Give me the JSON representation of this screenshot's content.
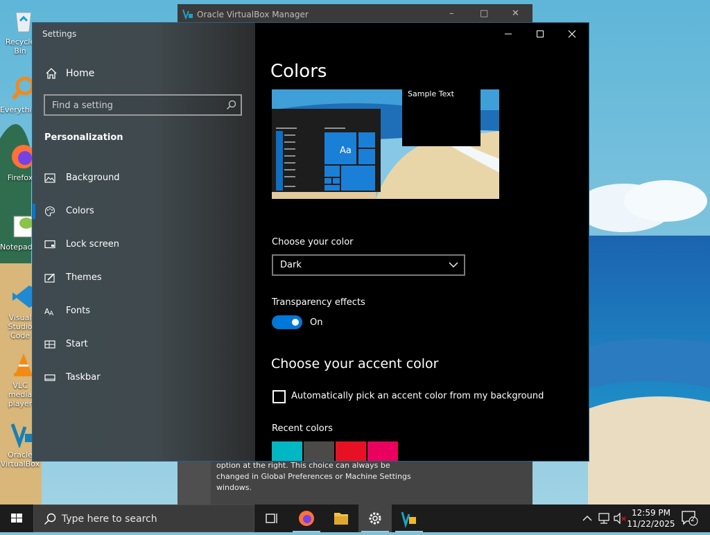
{
  "desktop": {
    "icons": [
      {
        "label": "Recycle Bin",
        "icon": "recycle-bin-icon"
      },
      {
        "label": "Everything",
        "icon": "everything-search-icon"
      },
      {
        "label": "Firefox",
        "icon": "firefox-icon"
      },
      {
        "label": "Notepad++",
        "icon": "notepadpp-icon"
      },
      {
        "label": "Visual Studio Code",
        "icon": "vscode-icon"
      },
      {
        "label": "VLC media player",
        "icon": "vlc-icon"
      },
      {
        "label": "Oracle VirtualBox",
        "icon": "virtualbox-icon"
      }
    ]
  },
  "vbox_window": {
    "title": "Oracle VirtualBox Manager",
    "body_text": "option at the right. This choice can always be changed in Global Preferences or Machine Settings windows."
  },
  "settings": {
    "app_title": "Settings",
    "home_label": "Home",
    "search_placeholder": "Find a setting",
    "section": "Personalization",
    "nav": [
      {
        "label": "Background",
        "icon": "background-icon"
      },
      {
        "label": "Colors",
        "icon": "colors-palette-icon",
        "selected": true
      },
      {
        "label": "Lock screen",
        "icon": "lock-screen-icon"
      },
      {
        "label": "Themes",
        "icon": "themes-icon"
      },
      {
        "label": "Fonts",
        "icon": "fonts-icon"
      },
      {
        "label": "Start",
        "icon": "start-icon"
      },
      {
        "label": "Taskbar",
        "icon": "taskbar-icon"
      }
    ],
    "page_title": "Colors",
    "preview": {
      "sample_text": "Sample Text",
      "tile_text": "Aa"
    },
    "choose_color_label": "Choose your color",
    "choose_color_value": "Dark",
    "transparency_label": "Transparency effects",
    "transparency_state": "On",
    "accent_title": "Choose your accent color",
    "auto_accent_label": "Automatically pick an accent color from my background",
    "recent_colors_label": "Recent colors",
    "recent_colors": [
      "#00b7c3",
      "#4c4a48",
      "#e81123",
      "#ea005e"
    ],
    "accent": "#0078d7"
  },
  "taskbar": {
    "search_placeholder": "Type here to search",
    "time": "12:59 PM",
    "date": "11/22/2025",
    "notification_count": "2"
  }
}
